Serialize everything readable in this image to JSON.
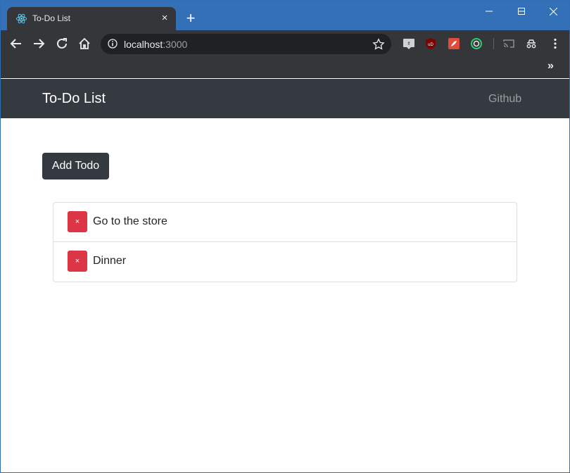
{
  "browser": {
    "tab_title": "To-Do List",
    "tab_close": "×",
    "new_tab": "+",
    "url_host": "localhost",
    "url_port": ":3000",
    "bookmarks_overflow": "»"
  },
  "app": {
    "brand": "To-Do List",
    "nav_link": "Github",
    "add_button": "Add Todo",
    "todos": [
      {
        "text": "Go to the store",
        "delete_label": "×"
      },
      {
        "text": "Dinner",
        "delete_label": "×"
      }
    ]
  },
  "colors": {
    "titlebar": "#3470b8",
    "toolbar": "#35363a",
    "navbar": "#343a40",
    "danger": "#dc3545"
  },
  "icons": {
    "favicon": "react-icon",
    "back": "back-arrow-icon",
    "forward": "forward-arrow-icon",
    "reload": "reload-icon",
    "home": "home-icon",
    "site_info": "info-icon",
    "bookmark": "star-icon",
    "menu": "kebab-menu-icon"
  }
}
